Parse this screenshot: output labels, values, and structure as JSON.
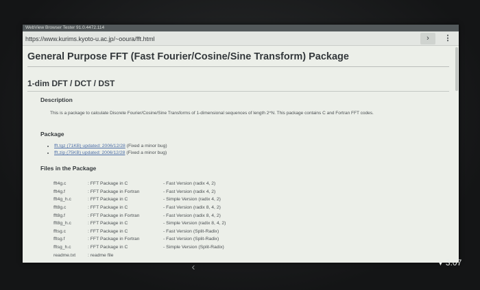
{
  "app": {
    "title": "WebView Browser Tester 91.0.4472.114"
  },
  "urlbar": {
    "url": "https://www.kurims.kyoto-u.ac.jp/~ooura/fft.html",
    "go_icon": "chevron-right-icon",
    "menu_icon": "more-vertical-icon"
  },
  "page": {
    "title": "General Purpose FFT (Fast Fourier/Cosine/Sine Transform) Package",
    "section": "1-dim DFT / DCT / DST",
    "description_heading": "Description",
    "description_text": "This is a package to calculate Discrete Fourier/Cosine/Sine Transforms of 1-dimensional sequences of length 2^N. This package contains C and Fortran FFT codes.",
    "package_heading": "Package",
    "packages": [
      {
        "link": "fft.tgz (71KB) updated: 2006/12/28",
        "note": "(Fixed a minor bug)"
      },
      {
        "link": "fft.zip (75KB) updated: 2006/12/28",
        "note": "(Fixed a minor bug)"
      }
    ],
    "files_heading": "Files in the Package",
    "files": [
      {
        "name": "fft4g.c",
        "desc": ": FFT Package in C",
        "version": "- Fast Version (radix 4, 2)"
      },
      {
        "name": "fft4g.f",
        "desc": ": FFT Package in Fortran",
        "version": "- Fast Version (radix 4, 2)"
      },
      {
        "name": "fft4g_h.c",
        "desc": ": FFT Package in C",
        "version": "- Simple Version (radix 4, 2)"
      },
      {
        "name": "fft8g.c",
        "desc": ": FFT Package in C",
        "version": "- Fast Version (radix 8, 4, 2)"
      },
      {
        "name": "fft8g.f",
        "desc": ": FFT Package in Fortran",
        "version": "- Fast Version (radix 8, 4, 2)"
      },
      {
        "name": "fft8g_h.c",
        "desc": ": FFT Package in C",
        "version": "- Simple Version (radix 8, 4, 2)"
      },
      {
        "name": "fftsg.c",
        "desc": ": FFT Package in C",
        "version": "- Fast Version (Split-Radix)"
      },
      {
        "name": "fftsg.f",
        "desc": ": FFT Package in Fortran",
        "version": "- Fast Version (Split-Radix)"
      },
      {
        "name": "fftsg_h.c",
        "desc": ": FFT Package in C",
        "version": "- Simple Version (Split-Radix)"
      },
      {
        "name": "readme.txt",
        "desc": ": readme file",
        "version": ""
      }
    ]
  },
  "system": {
    "time": "3:07",
    "back_icon": "back-arrow-icon",
    "wifi_icon": "wifi-icon"
  }
}
